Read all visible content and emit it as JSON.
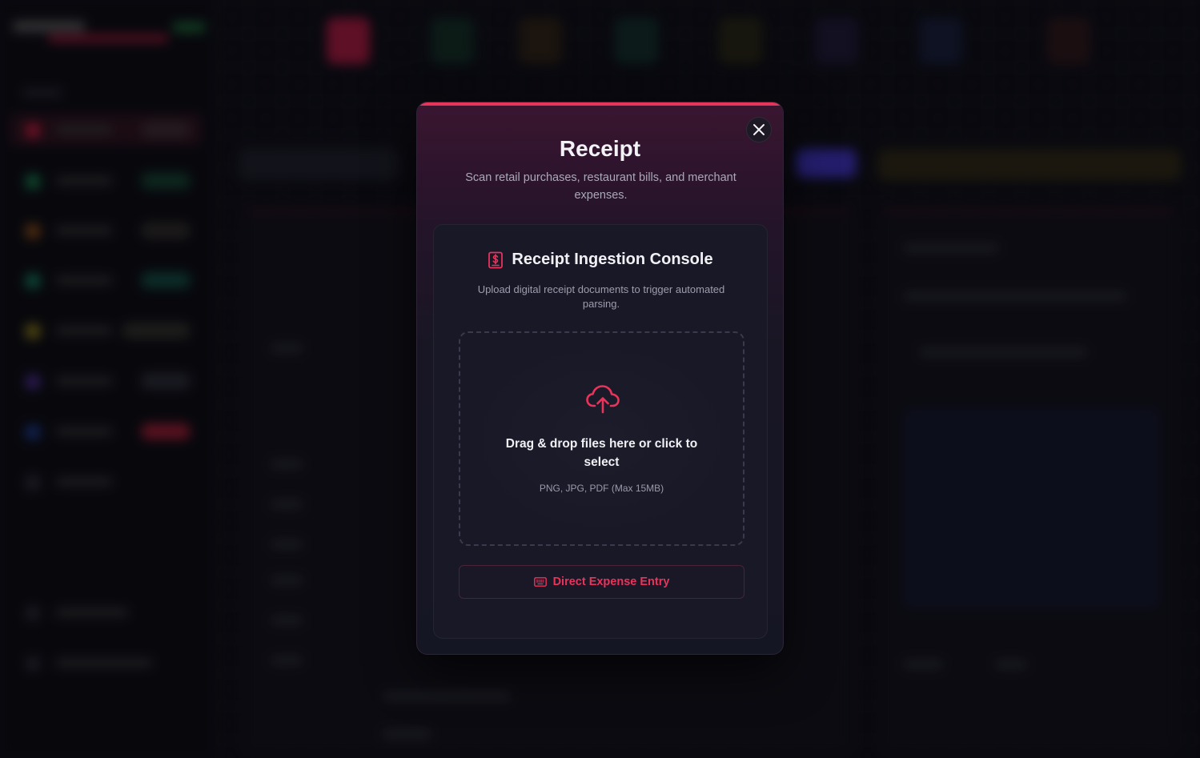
{
  "modal": {
    "title": "Receipt",
    "subtitle": "Scan retail purchases, restaurant bills, and merchant expenses.",
    "accent_color": "#e8345b",
    "close_icon": "close-icon"
  },
  "console": {
    "icon": "receipt-dollar-icon",
    "title": "Receipt Ingestion Console",
    "description": "Upload digital receipt documents to trigger automated parsing.",
    "dropzone": {
      "icon": "cloud-upload-icon",
      "title": "Drag & drop files here or click to select",
      "hint": "PNG, JPG, PDF (Max 15MB)"
    },
    "manual_button": {
      "icon": "keyboard-icon",
      "label": "Direct Expense Entry"
    }
  }
}
